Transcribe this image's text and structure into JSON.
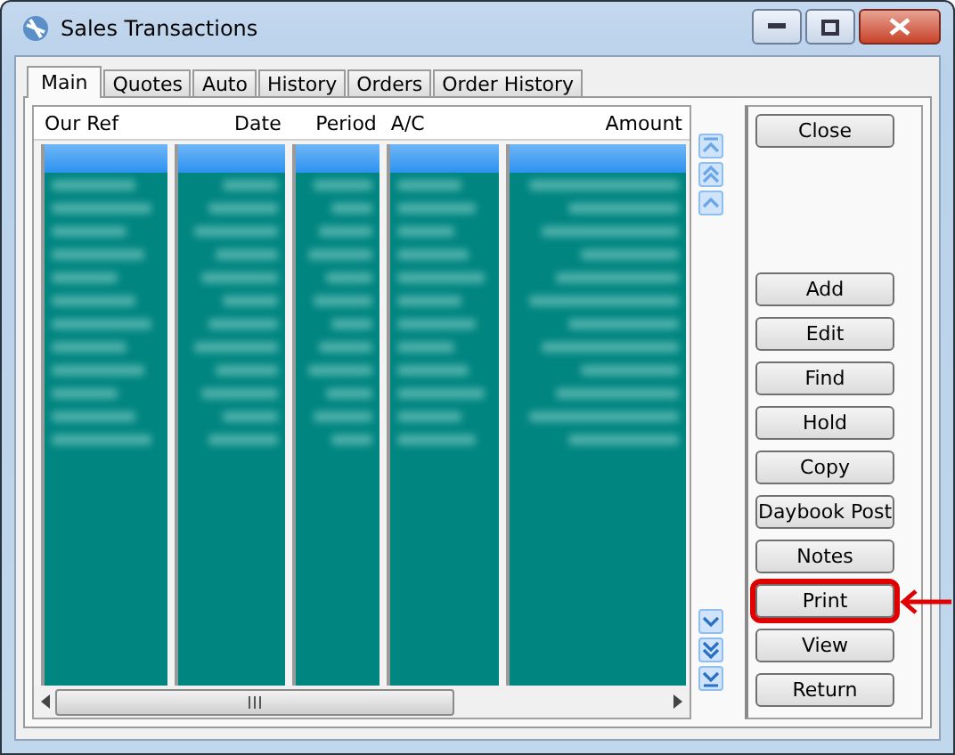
{
  "window": {
    "title": "Sales Transactions"
  },
  "tabs": [
    {
      "label": "Main",
      "selected": true
    },
    {
      "label": "Quotes",
      "selected": false
    },
    {
      "label": "Auto",
      "selected": false
    },
    {
      "label": "History",
      "selected": false
    },
    {
      "label": "Orders",
      "selected": false
    },
    {
      "label": "Order History",
      "selected": false
    }
  ],
  "table": {
    "columns": [
      {
        "label": "Our Ref"
      },
      {
        "label": "Date"
      },
      {
        "label": "Period"
      },
      {
        "label": "A/C"
      },
      {
        "label": "Amount"
      }
    ],
    "rows": [
      {
        "selected": true
      },
      {
        "selected": false
      },
      {
        "selected": false
      },
      {
        "selected": false
      },
      {
        "selected": false
      },
      {
        "selected": false
      },
      {
        "selected": false
      },
      {
        "selected": false
      },
      {
        "selected": false
      },
      {
        "selected": false
      },
      {
        "selected": false
      },
      {
        "selected": false
      },
      {
        "selected": false
      }
    ]
  },
  "buttons": [
    {
      "label": "Close",
      "kind": "top",
      "highlighted": false
    },
    {
      "label": "Add",
      "kind": "action",
      "highlighted": false
    },
    {
      "label": "Edit",
      "kind": "action",
      "highlighted": false
    },
    {
      "label": "Find",
      "kind": "action",
      "highlighted": false
    },
    {
      "label": "Hold",
      "kind": "action",
      "highlighted": false
    },
    {
      "label": "Copy",
      "kind": "action",
      "highlighted": false
    },
    {
      "label": "Daybook Post",
      "kind": "action",
      "highlighted": false
    },
    {
      "label": "Notes",
      "kind": "action",
      "highlighted": false
    },
    {
      "label": "Print",
      "kind": "action",
      "highlighted": true
    },
    {
      "label": "View",
      "kind": "action",
      "highlighted": false
    },
    {
      "label": "Return",
      "kind": "action",
      "highlighted": false
    }
  ]
}
